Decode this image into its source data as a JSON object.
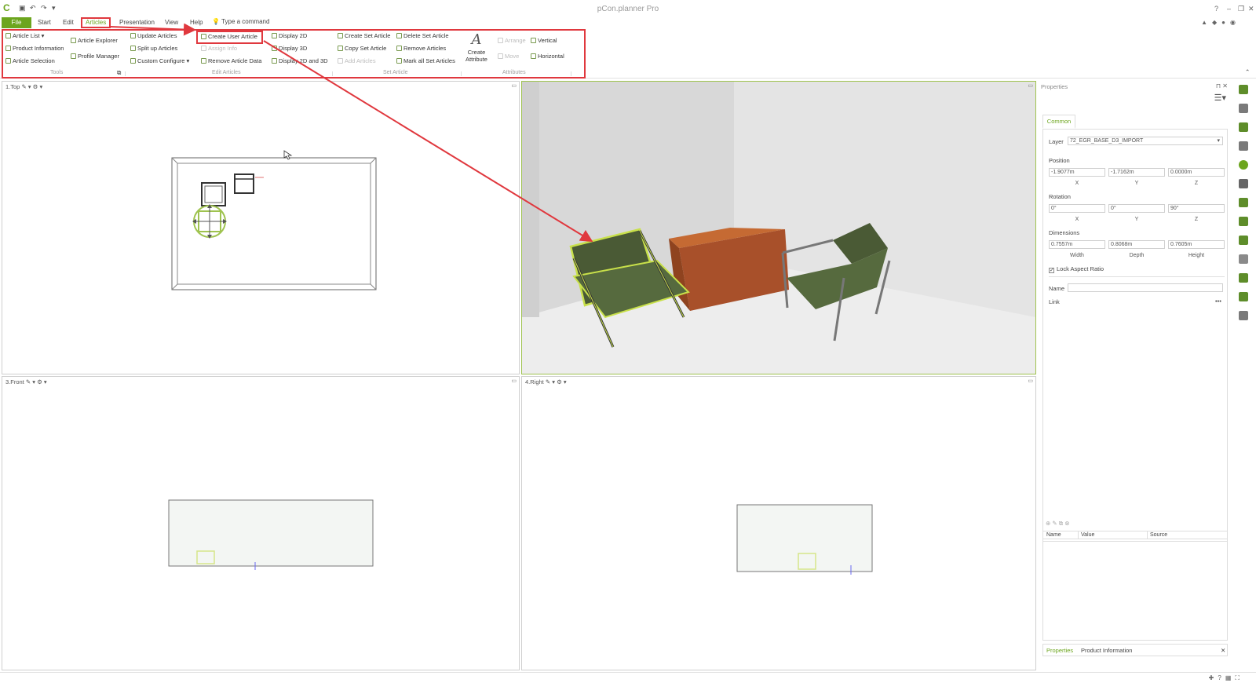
{
  "app": {
    "title": "pCon.planner Pro"
  },
  "menu": {
    "tabs": [
      "File",
      "Start",
      "Edit",
      "Articles",
      "Presentation",
      "View",
      "Help"
    ],
    "active": "Articles",
    "command_label": "Type a command"
  },
  "ribbon": {
    "tools": {
      "label": "Tools",
      "items": [
        "Article List",
        "Product Information",
        "Article Selection",
        "Article Explorer",
        "Profile Manager",
        "Update Articles",
        "Split up Articles",
        "Custom Configure"
      ]
    },
    "edit_articles": {
      "label": "Edit Articles",
      "items": [
        "Create User Article",
        "Assign Info",
        "Remove Article Data",
        "Display 2D",
        "Display 3D",
        "Display 2D and 3D"
      ]
    },
    "set_article": {
      "label": "Set Article",
      "items": [
        "Create Set Article",
        "Copy Set Article",
        "Add Articles",
        "Delete Set Article",
        "Remove Articles",
        "Mark all Set Articles"
      ]
    },
    "attributes": {
      "label": "Attributes",
      "create_line1": "Create",
      "create_line2": "Attribute",
      "items": [
        "Arrange",
        "Move",
        "Vertical",
        "Horizontal"
      ]
    }
  },
  "viewports": {
    "top": "1.Top",
    "front": "3.Front",
    "right": "4.Right"
  },
  "properties": {
    "title": "Properties",
    "tab": "Common",
    "layer_label": "Layer",
    "layer_value": "72_EGR_BASE_D3_IMPORT",
    "position_label": "Position",
    "position": {
      "x": "-1.9077m",
      "y": "-1.7162m",
      "z": "0.0000m"
    },
    "rotation_label": "Rotation",
    "rotation": {
      "x": "0°",
      "y": "0°",
      "z": "90°"
    },
    "dimensions_label": "Dimensions",
    "dimensions": {
      "width": "0.7557m",
      "depth": "0.8068m",
      "height": "0.7605m"
    },
    "axis": {
      "x": "X",
      "y": "Y",
      "z": "Z"
    },
    "dim_labels": {
      "width": "Width",
      "depth": "Depth",
      "height": "Height"
    },
    "lock_aspect": "Lock Aspect Ratio",
    "name_label": "Name",
    "link_label": "Link",
    "table_cols": [
      "Name",
      "Value",
      "Source"
    ],
    "bottom_tabs": [
      "Properties",
      "Product Information"
    ]
  },
  "colors": {
    "accent": "#6ca51e",
    "highlight": "#e0383e",
    "chair_fabric": "#4a5a35",
    "table_wood": "#b8602a"
  }
}
